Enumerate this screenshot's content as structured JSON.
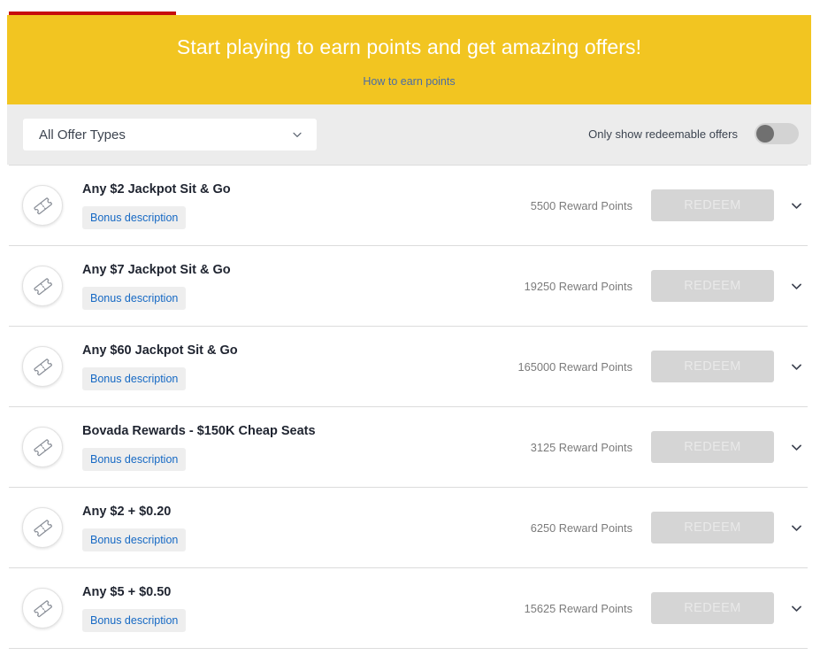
{
  "theme": {
    "banner_bg": "#f2c521",
    "accent_red": "#c60c0c",
    "link_blue": "#4a6ca5",
    "chip_blue": "#1669c4",
    "filter_bg": "#ececec",
    "button_disabled_bg": "#d5d5d5"
  },
  "banner": {
    "title": "Start playing to earn points and get amazing offers!",
    "link_label": "How to earn points"
  },
  "filters": {
    "offer_type_selected": "All Offer Types",
    "offer_type_options": [
      "All Offer Types"
    ],
    "redeemable_toggle_label": "Only show redeemable offers",
    "redeemable_toggle_on": false
  },
  "offers": {
    "redeem_label": "REDEEM",
    "bonus_chip_label": "Bonus description",
    "points_suffix": "Reward Points",
    "items": [
      {
        "title": "Any $2 Jackpot Sit & Go",
        "points": "5500 Reward Points",
        "chip": "Bonus description",
        "redeem": "REDEEM"
      },
      {
        "title": "Any $7 Jackpot Sit & Go",
        "points": "19250 Reward Points",
        "chip": "Bonus description",
        "redeem": "REDEEM"
      },
      {
        "title": "Any $60 Jackpot Sit & Go",
        "points": "165000 Reward Points",
        "chip": "Bonus description",
        "redeem": "REDEEM"
      },
      {
        "title": "Bovada Rewards - $150K Cheap Seats",
        "points": "3125 Reward Points",
        "chip": "Bonus description",
        "redeem": "REDEEM"
      },
      {
        "title": "Any $2 + $0.20",
        "points": "6250 Reward Points",
        "chip": "Bonus description",
        "redeem": "REDEEM"
      },
      {
        "title": "Any $5 + $0.50",
        "points": "15625 Reward Points",
        "chip": "Bonus description",
        "redeem": "REDEEM"
      }
    ]
  },
  "icons": {
    "ticket": "ticket-icon",
    "chevron_down": "chevron-down-icon"
  }
}
